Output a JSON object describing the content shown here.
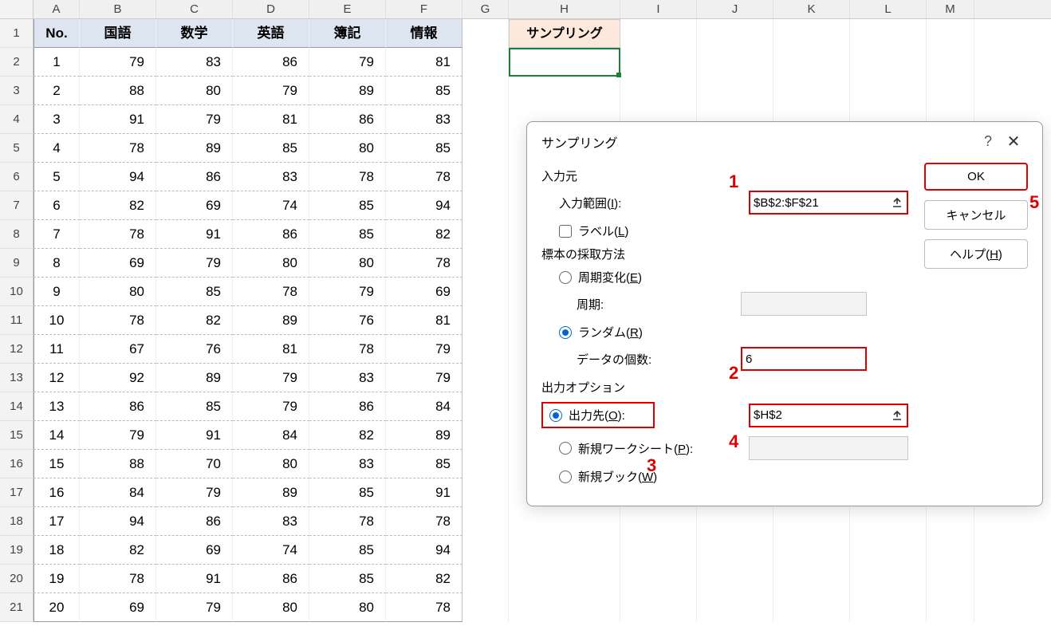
{
  "columns": [
    "A",
    "B",
    "C",
    "D",
    "E",
    "F",
    "G",
    "H",
    "I",
    "J",
    "K",
    "L",
    "M"
  ],
  "rowNumbers": [
    1,
    2,
    3,
    4,
    5,
    6,
    7,
    8,
    9,
    10,
    11,
    12,
    13,
    14,
    15,
    16,
    17,
    18,
    19,
    20,
    21
  ],
  "tableHeaders": {
    "A": "No.",
    "B": "国語",
    "C": "数学",
    "D": "英語",
    "E": "簿記",
    "F": "情報"
  },
  "h1Label": "サンプリング",
  "tableRows": [
    {
      "no": 1,
      "b": 79,
      "c": 83,
      "d": 86,
      "e": 79,
      "f": 81
    },
    {
      "no": 2,
      "b": 88,
      "c": 80,
      "d": 79,
      "e": 89,
      "f": 85
    },
    {
      "no": 3,
      "b": 91,
      "c": 79,
      "d": 81,
      "e": 86,
      "f": 83
    },
    {
      "no": 4,
      "b": 78,
      "c": 89,
      "d": 85,
      "e": 80,
      "f": 85
    },
    {
      "no": 5,
      "b": 94,
      "c": 86,
      "d": 83,
      "e": 78,
      "f": 78
    },
    {
      "no": 6,
      "b": 82,
      "c": 69,
      "d": 74,
      "e": 85,
      "f": 94
    },
    {
      "no": 7,
      "b": 78,
      "c": 91,
      "d": 86,
      "e": 85,
      "f": 82
    },
    {
      "no": 8,
      "b": 69,
      "c": 79,
      "d": 80,
      "e": 80,
      "f": 78
    },
    {
      "no": 9,
      "b": 80,
      "c": 85,
      "d": 78,
      "e": 79,
      "f": 69
    },
    {
      "no": 10,
      "b": 78,
      "c": 82,
      "d": 89,
      "e": 76,
      "f": 81
    },
    {
      "no": 11,
      "b": 67,
      "c": 76,
      "d": 81,
      "e": 78,
      "f": 79
    },
    {
      "no": 12,
      "b": 92,
      "c": 89,
      "d": 79,
      "e": 83,
      "f": 79
    },
    {
      "no": 13,
      "b": 86,
      "c": 85,
      "d": 79,
      "e": 86,
      "f": 84
    },
    {
      "no": 14,
      "b": 79,
      "c": 91,
      "d": 84,
      "e": 82,
      "f": 89
    },
    {
      "no": 15,
      "b": 88,
      "c": 70,
      "d": 80,
      "e": 83,
      "f": 85
    },
    {
      "no": 16,
      "b": 84,
      "c": 79,
      "d": 89,
      "e": 85,
      "f": 91
    },
    {
      "no": 17,
      "b": 94,
      "c": 86,
      "d": 83,
      "e": 78,
      "f": 78
    },
    {
      "no": 18,
      "b": 82,
      "c": 69,
      "d": 74,
      "e": 85,
      "f": 94
    },
    {
      "no": 19,
      "b": 78,
      "c": 91,
      "d": 86,
      "e": 85,
      "f": 82
    },
    {
      "no": 20,
      "b": 69,
      "c": 79,
      "d": 80,
      "e": 80,
      "f": 78
    }
  ],
  "dialog": {
    "title": "サンプリング",
    "sectionInput": "入力元",
    "inputRangeLabel": "入力範囲(",
    "inputRangeKey": "I",
    "inputRangeSuffix": "):",
    "inputRangeValue": "$B$2:$F$21",
    "labelsLabel": "ラベル(",
    "labelsKey": "L",
    "labelsSuffix": ")",
    "sectionMethod": "標本の採取方法",
    "periodicLabel": "周期変化(",
    "periodicKey": "E",
    "periodicSuffix": ")",
    "periodFieldLabel": "周期:",
    "randomLabel": "ランダム(",
    "randomKey": "R",
    "randomSuffix": ")",
    "countLabel": "データの個数:",
    "countValue": "6",
    "sectionOutput": "出力オプション",
    "outRangeLabel": "出力先(",
    "outRangeKey": "O",
    "outRangeSuffix": "):",
    "outRangeValue": "$H$2",
    "newSheetLabel": "新規ワークシート(",
    "newSheetKey": "P",
    "newSheetSuffix": "):",
    "newBookLabel": "新規ブック(",
    "newBookKey": "W",
    "newBookSuffix": ")",
    "okLabel": "OK",
    "cancelLabel": "キャンセル",
    "helpLabel": "ヘルプ(",
    "helpKey": "H",
    "helpSuffix": ")"
  },
  "annotations": {
    "a1": "1",
    "a2": "2",
    "a3": "3",
    "a4": "4",
    "a5": "5"
  }
}
